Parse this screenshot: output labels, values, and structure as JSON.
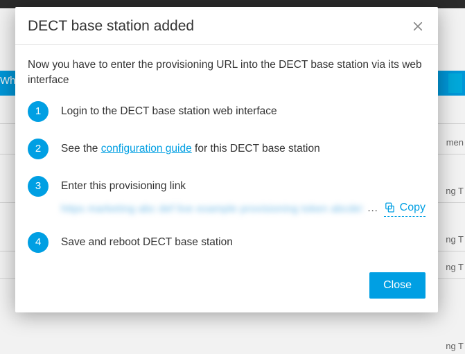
{
  "background": {
    "wh_fragment": "Wh",
    "side1": "men",
    "side2": "ng T",
    "side3": "ng T",
    "side4": "ng T",
    "side5": "ng T"
  },
  "modal": {
    "title": "DECT base station added",
    "intro": "Now you have to enter the provisioning URL into the DECT base station via its web interface",
    "steps": {
      "s1": {
        "num": "1",
        "text": "Login to the DECT base station web interface"
      },
      "s2": {
        "num": "2",
        "before": "See the ",
        "link": "configuration guide",
        "after": " for this DECT base station"
      },
      "s3": {
        "num": "3",
        "text": "Enter this provisioning link"
      },
      "s4": {
        "num": "4",
        "text": "Save and reboot DECT base station"
      }
    },
    "provisioning_placeholder": "https marketing abc def live example provisioning token abcdef",
    "ellipsis": "…",
    "copy_label": "Copy",
    "close_label": "Close"
  }
}
